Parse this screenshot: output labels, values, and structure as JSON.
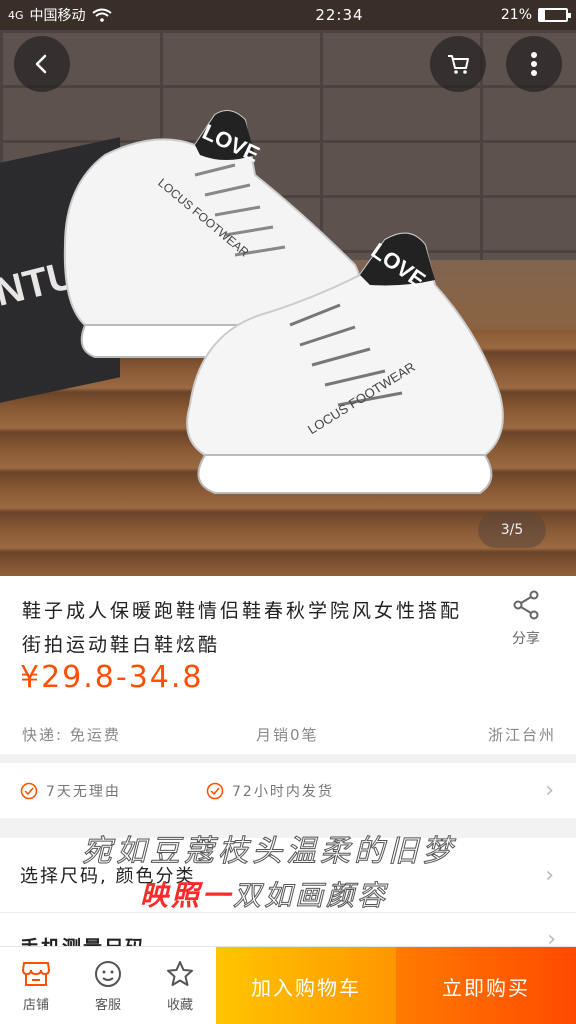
{
  "status_bar": {
    "signal": "4G",
    "carrier": "中国移动",
    "time": "22:34",
    "battery_percent": "21%",
    "battery_level": 0.21
  },
  "hero": {
    "box_text": "NTURY",
    "shoe_brand_text": "LOCUS FOOTWEAR",
    "shoe_tag_text": "LOVE",
    "pager": "3/5"
  },
  "product": {
    "title": "鞋子成人保暖跑鞋情侣鞋春秋学院风女性搭配街拍运动鞋白鞋炫酷",
    "share_label": "分享",
    "price": "¥29.8-34.8"
  },
  "meta": {
    "shipping": "快递: 免运费",
    "monthly_sales": "月销0笔",
    "location": "浙江台州"
  },
  "services": [
    {
      "label": "7天无理由"
    },
    {
      "label": "72小时内发货"
    }
  ],
  "options": {
    "label": "选择尺码, 颜色分类"
  },
  "measure": {
    "label": "手机测量尺码"
  },
  "overlay": {
    "line1": "宛如豆蔻枝头温柔的旧梦",
    "line2_highlight": "映照一",
    "line2_rest": "双如画颜容"
  },
  "bottom_bar": {
    "store": "店铺",
    "service": "客服",
    "favorite": "收藏",
    "add_to_cart": "加入购物车",
    "buy_now": "立即购买"
  },
  "colors": {
    "price": "#ff5000",
    "add_cart_bg": "#ffa800",
    "buy_now_bg": "#ff5500"
  }
}
